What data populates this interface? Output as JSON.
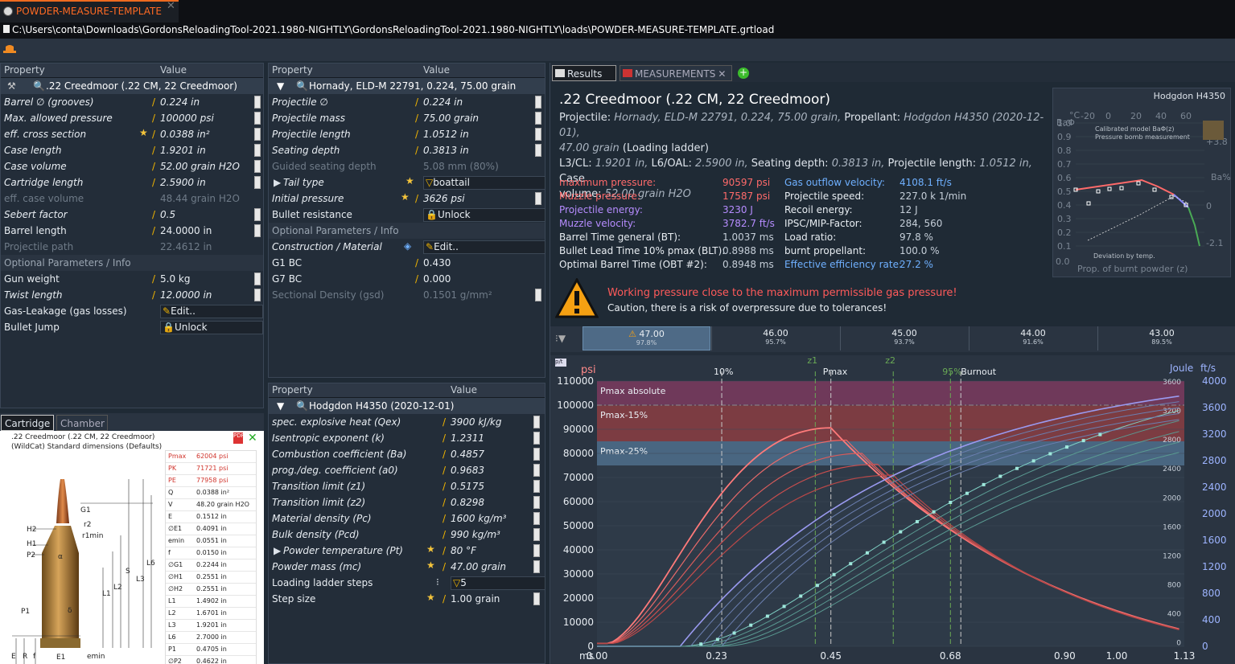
{
  "window": {
    "tab_title": "POWDER-MEASURE-TEMPLATE",
    "path": "C:\\Users\\conta\\Downloads\\GordonsReloadingTool-2021.1980-NIGHTLY\\GordonsReloadingTool-2021.1980-NIGHTLY\\loads\\POWDER-MEASURE-TEMPLATE.grtload"
  },
  "left_panel": {
    "col_property": "Property",
    "col_value": "Value",
    "selector": ".22 Creedmoor (.22 CM, 22 Creedmoor)",
    "rows": [
      {
        "k": "Barrel ∅ (grooves)",
        "v": "0.224 in"
      },
      {
        "k": "Max. allowed pressure",
        "v": "100000 psi"
      },
      {
        "k": "eff. cross section",
        "v": "0.0388 in²"
      },
      {
        "k": "Case length",
        "v": "1.9201 in"
      },
      {
        "k": "Case volume",
        "v": "52.00 grain H2O"
      },
      {
        "k": "Cartridge length",
        "v": "2.5900 in"
      },
      {
        "k": "eff. case volume",
        "v": "48.44 grain H2O"
      },
      {
        "k": "Sebert factor",
        "v": "0.5"
      },
      {
        "k": "Barrel length",
        "v": "24.0000 in"
      },
      {
        "k": "Projectile path",
        "v": "22.4612 in"
      }
    ],
    "section": "Optional Parameters / Info",
    "rows2": [
      {
        "k": "Gun weight",
        "v": "5.0 kg"
      },
      {
        "k": "Twist length",
        "v": "12.0000 in"
      },
      {
        "k": "Gas-Leakage (gas losses)",
        "v": "Edit.."
      },
      {
        "k": "Bullet Jump",
        "v": "Unlock"
      }
    ]
  },
  "cartridge_panel": {
    "tabs": [
      "Cartridge",
      "Chamber"
    ],
    "title1": ".22 Creedmoor (.22 CM, 22 Creedmoor)",
    "title2": "(WildCat) Standard dimensions (Defaults)",
    "specs": [
      {
        "k": "Pmax",
        "v": "62004 psi"
      },
      {
        "k": "PK",
        "v": "71721 psi"
      },
      {
        "k": "PE",
        "v": "77958 psi"
      },
      {
        "k": "Q",
        "v": "0.0388 in²"
      },
      {
        "k": "V",
        "v": "48.20 grain H2O"
      },
      {
        "k": "E",
        "v": "0.1512 in"
      },
      {
        "k": "∅E1",
        "v": "0.4091 in"
      },
      {
        "k": "emin",
        "v": "0.0551 in"
      },
      {
        "k": "f",
        "v": "0.0150 in"
      },
      {
        "k": "∅G1",
        "v": "0.2244 in"
      },
      {
        "k": "∅H1",
        "v": "0.2551 in"
      },
      {
        "k": "∅H2",
        "v": "0.2551 in"
      },
      {
        "k": "L1",
        "v": "1.4902 in"
      },
      {
        "k": "L2",
        "v": "1.6701 in"
      },
      {
        "k": "L3",
        "v": "1.9201 in"
      },
      {
        "k": "L6",
        "v": "2.7000 in"
      },
      {
        "k": "P1",
        "v": "0.4705 in"
      },
      {
        "k": "∅P2",
        "v": "0.4622 in"
      }
    ],
    "dim_labels": [
      "G1",
      "r2",
      "r1min",
      "H2",
      "H1",
      "P2",
      "α",
      "L6",
      "S",
      "L3",
      "L2",
      "L1",
      "P1",
      "δ",
      "E",
      "R",
      "f",
      "E1",
      "emin",
      "R1"
    ]
  },
  "mid_panel": {
    "col_property": "Property",
    "col_value": "Value",
    "selector": "Hornady, ELD-M 22791, 0.224, 75.00 grain",
    "rows": [
      {
        "k": "Projectile ∅",
        "v": "0.224 in"
      },
      {
        "k": "Projectile mass",
        "v": "75.00 grain"
      },
      {
        "k": "Projectile length",
        "v": "1.0512 in"
      },
      {
        "k": "Seating depth",
        "v": "0.3813 in"
      },
      {
        "k": "Guided seating depth",
        "v": "5.08 mm (80%)"
      },
      {
        "k": "Tail type",
        "v": "boattail"
      },
      {
        "k": "Initial pressure",
        "v": "3626 psi"
      },
      {
        "k": "Bullet resistance",
        "v": "Unlock"
      }
    ],
    "section": "Optional Parameters / Info",
    "rows2": [
      {
        "k": "Construction / Material",
        "v": "Edit.."
      },
      {
        "k": "G1 BC",
        "v": "0.430"
      },
      {
        "k": "G7 BC",
        "v": "0.000"
      },
      {
        "k": "Sectional Density (gsd)",
        "v": "0.1501 g/mm²"
      }
    ]
  },
  "powder_panel": {
    "col_property": "Property",
    "col_value": "Value",
    "selector": "Hodgdon H4350 (2020-12-01)",
    "rows": [
      {
        "k": "spec. explosive heat (Qex)",
        "v": "3900 kJ/kg"
      },
      {
        "k": "Isentropic exponent (k)",
        "v": "1.2311"
      },
      {
        "k": "Combustion coefficient (Ba)",
        "v": "0.4857"
      },
      {
        "k": "prog./deg. coefficient (a0)",
        "v": "0.9683"
      },
      {
        "k": "Transition limit (z1)",
        "v": "0.5175"
      },
      {
        "k": "Transition limit (z2)",
        "v": "0.8298"
      },
      {
        "k": "Material density (Pc)",
        "v": "1600 kg/m³"
      },
      {
        "k": "Bulk density (Pcd)",
        "v": "990 kg/m³"
      },
      {
        "k": "Powder temperature (Pt)",
        "v": "80 °F"
      },
      {
        "k": "Powder mass (mc)",
        "v": "47.00 grain"
      },
      {
        "k": "Loading ladder steps",
        "v": "5"
      },
      {
        "k": "Step size",
        "v": "1.00 grain"
      }
    ]
  },
  "results": {
    "tabs": [
      "Results",
      "MEASUREMENTS"
    ],
    "title": ".22 Creedmoor (.22 CM, 22 Creedmoor)",
    "line1_label": "Projectile:",
    "line1_val": "Hornady, ELD-M 22791, 0.224, 75.00 grain,",
    "line1_label2": "Propellant:",
    "line1_val2": "Hodgdon H4350 (2020-12-01),",
    "line2_val": "47.00 grain",
    "line2_rest": "(Loading ladder)",
    "l3_label": "L3/CL:",
    "l3_val": "1.9201 in,",
    "l6_label": "L6/OAL:",
    "l6_val": "2.5900 in,",
    "sd_label": "Seating depth:",
    "sd_val": "0.3813 in,",
    "pl_label": "Projectile length:",
    "pl_val": "1.0512 in,",
    "case_label": "Case",
    "vol_label": "volume:",
    "vol_val": "52.00 grain H2O",
    "stats_left": [
      {
        "k": "maximum pressure:",
        "v": "90597 psi",
        "c": "#ff6a6a"
      },
      {
        "k": "Muzzle pressure:",
        "v": "17587 psi",
        "c": "#ff6a6a"
      },
      {
        "k": "Projectile energy:",
        "v": "3230 J",
        "c": "#b68cff"
      },
      {
        "k": "Muzzle velocity:",
        "v": "3782.7 ft/s",
        "c": "#b68cff"
      },
      {
        "k": "Barrel Time general (BT):",
        "v": "1.0037 ms",
        "c": "#e8edf2"
      },
      {
        "k": "Bullet Lead Time 10% pmax (BLT):",
        "v": "0.8988 ms",
        "c": "#e8edf2"
      },
      {
        "k": "Optimal Barrel Time (OBT #2):",
        "v": "0.8948 ms",
        "c": "#e8edf2"
      }
    ],
    "stats_right": [
      {
        "k": "Gas outflow velocity:",
        "v": "4108.1 ft/s",
        "c": "#6fb0ff"
      },
      {
        "k": "Projectile speed:",
        "v": "227.0 k 1/min",
        "c": "#e8edf2"
      },
      {
        "k": "Recoil energy:",
        "v": "12 J",
        "c": "#e8edf2"
      },
      {
        "k": "IPSC/MIP-Factor:",
        "v": "284, 560",
        "c": "#e8edf2"
      },
      {
        "k": "Load ratio:",
        "v": "97.8 %",
        "c": "#e8edf2"
      },
      {
        "k": "burnt propellant:",
        "v": "100.0 %",
        "c": "#e8edf2"
      },
      {
        "k": "Effective efficiency rate:",
        "v": "27.2 %",
        "c": "#6fb0ff"
      }
    ],
    "warn1": "Working pressure close to the maximum permissible gas pressure!",
    "warn2": "Caution, there is a risk of overpressure due to tolerances!",
    "ladder": [
      {
        "a": "47.00",
        "b": "97.8%"
      },
      {
        "a": "46.00",
        "b": "95.7%"
      },
      {
        "a": "45.00",
        "b": "93.7%"
      },
      {
        "a": "44.00",
        "b": "91.6%"
      },
      {
        "a": "43.00",
        "b": "89.5%"
      }
    ]
  },
  "mini_chart": {
    "title": "Hodgdon H4350",
    "legend1": "Calibrated model BaΦ(z)",
    "legend2": "Pressure bomb measurement",
    "legend3": "Deviation by temp.",
    "xlabel": "Prop. of burnt powder (z)",
    "y_left_label": "BaΦ",
    "y_right_label": "Ba%",
    "temp_label": "°C",
    "temp_ticks": [
      "-20",
      "0",
      "20",
      "40",
      "60"
    ],
    "y_ticks": [
      "1.0",
      "0.9",
      "0.8",
      "0.7",
      "0.6",
      "0.5",
      "0.4",
      "0.3",
      "0.2",
      "0.1",
      "0.0"
    ],
    "y_right_ticks": [
      "+3.8",
      "0",
      "-2.1"
    ]
  },
  "chart_data": {
    "type": "line",
    "x_unit": "ms",
    "x_ticks": [
      "0.00",
      "0.23",
      "0.45",
      "0.68",
      "0.90",
      "1.00",
      "1.13"
    ],
    "xlim": [
      0,
      1.13
    ],
    "y_left_label": "psi",
    "y_left_ticks": [
      "110000",
      "100000",
      "90000",
      "80000",
      "70000",
      "60000",
      "50000",
      "40000",
      "30000",
      "20000",
      "10000",
      "0"
    ],
    "ylim": [
      0,
      110000
    ],
    "y_joule_label": "Joule",
    "y_joule_ticks": [
      "3600",
      "3200",
      "2800",
      "2400",
      "2000",
      "1600",
      "1200",
      "800",
      "400",
      "0"
    ],
    "y_fts_label": "ft/s",
    "y_fts_ticks": [
      "4000",
      "3600",
      "3200",
      "2800",
      "2400",
      "2000",
      "1600",
      "1200",
      "800",
      "400",
      "0"
    ],
    "bands": [
      {
        "label": "Pmax absolute",
        "from": 100000,
        "to": 110000,
        "color": "#7a3a5e"
      },
      {
        "label": "Pmax-15%",
        "from": 85000,
        "to": 100000,
        "color": "#8a3d42"
      },
      {
        "label": "Pmax-25%",
        "from": 75000,
        "to": 85000,
        "color": "#4d6e8c"
      }
    ],
    "markers": [
      {
        "label": "10%",
        "x": 0.24
      },
      {
        "label": "z1",
        "x": 0.42
      },
      {
        "label": "Pmax",
        "x": 0.45
      },
      {
        "label": "z2",
        "x": 0.57
      },
      {
        "label": "95%",
        "x": 0.68
      },
      {
        "label": "Burnout",
        "x": 0.7
      }
    ],
    "series": [
      {
        "name": "pressure",
        "peak_x": [
          0.45,
          0.48,
          0.51,
          0.54,
          0.57
        ],
        "peak_y": [
          90597,
          85500,
          80000,
          75500,
          71000
        ]
      },
      {
        "name": "velocity",
        "end": [
          3782.7,
          3700,
          3610,
          3520,
          3430
        ]
      }
    ]
  }
}
